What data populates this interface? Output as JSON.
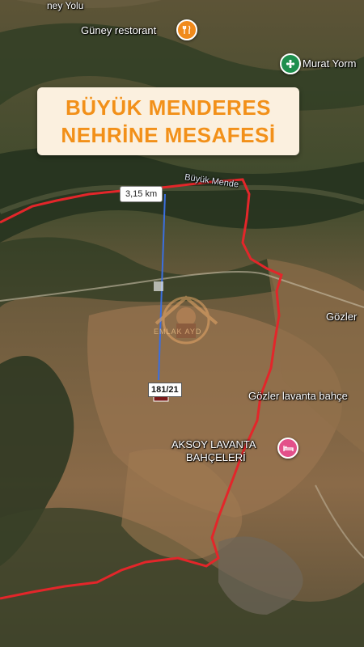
{
  "title": {
    "line1": "BÜYÜK MENDERES",
    "line2": "NEHRİNE MESAFESİ"
  },
  "labels": {
    "top_road": "ney Yolu",
    "restaurant": "Güney restorant",
    "murat": "Murat Yorm",
    "river": "Büyük Mende",
    "gozler": "Gözler",
    "gozler_lavanta": "Gözler lavanta bahçe",
    "aksoy_line1": "AKSOY LAVANTA",
    "aksoy_line2": "BAHÇELERİ"
  },
  "measurement": {
    "distance": "3,15 km"
  },
  "parcel": {
    "id": "181/21"
  },
  "watermark": {
    "text": "EMLAK AYD"
  },
  "colors": {
    "title_text": "#f29019",
    "title_bg": "#fbf0df",
    "boundary": "#e3262a",
    "measure_line": "#3b6fe0",
    "restaurant_pin": "#f08a1c",
    "park_pin": "#1e8f4e",
    "hotel_pin": "#e3508a"
  },
  "icons": {
    "restaurant": "fork-knife-icon",
    "park": "flower-icon",
    "hotel": "bed-icon"
  }
}
